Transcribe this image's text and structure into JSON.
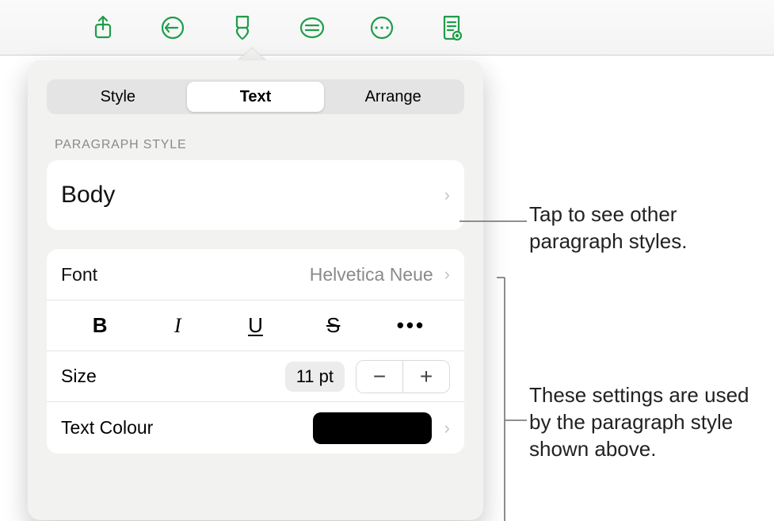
{
  "toolbar": {
    "icons": [
      "share-icon",
      "undo-icon",
      "format-brush-icon",
      "insert-icon",
      "more-icon",
      "view-icon"
    ]
  },
  "tabs": {
    "style": "Style",
    "text": "Text",
    "arrange": "Arrange",
    "active": "text"
  },
  "section": {
    "paragraph_style_label": "PARAGRAPH STYLE",
    "current_style": "Body"
  },
  "font": {
    "label": "Font",
    "value": "Helvetica Neue"
  },
  "textstyle": {
    "bold": "B",
    "italic": "I",
    "underline": "U",
    "strike": "S",
    "more": "•••"
  },
  "size": {
    "label": "Size",
    "value": "11 pt",
    "minus": "−",
    "plus": "+"
  },
  "textcolor": {
    "label": "Text Colour",
    "hex": "#000000"
  },
  "annotations": {
    "a1": "Tap to see other paragraph styles.",
    "a2": "These settings are used by the paragraph style shown above."
  }
}
